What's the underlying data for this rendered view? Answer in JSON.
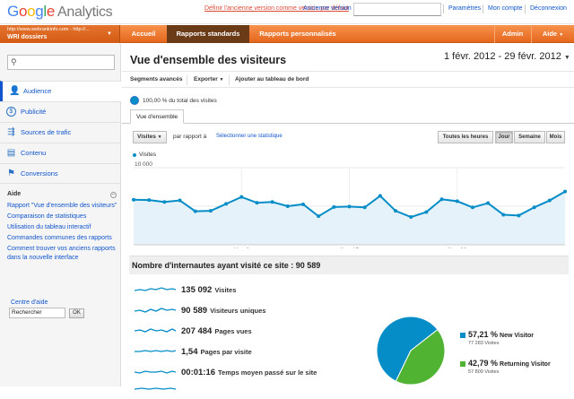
{
  "colors": {
    "accent_orange": "#e5671d",
    "link_blue": "#1155cc",
    "series_blue": "#058dc7",
    "series_green": "#50b432"
  },
  "topbar": {
    "logo_google": "Google",
    "logo_product": "Analytics",
    "make_default": "Définir l'ancienne version comme version par défaut",
    "old_version": "Ancienne version",
    "settings": "Paramètres",
    "account": "Mon compte",
    "logout": "Déconnexion"
  },
  "navbar": {
    "account_url": "http://www.webrankinfo.com - http://...",
    "account_name": "WRI dossiers",
    "home": "Accueil",
    "standard_reports": "Rapports standards",
    "custom_reports": "Rapports personnalisés",
    "admin": "Admin",
    "help": "Aide"
  },
  "sidebar": {
    "search_icon": "search-icon",
    "items": [
      {
        "label": "Audience",
        "icon": "person-icon"
      },
      {
        "label": "Publicité",
        "icon": "dollar-icon"
      },
      {
        "label": "Sources de trafic",
        "icon": "traffic-icon"
      },
      {
        "label": "Contenu",
        "icon": "content-icon"
      },
      {
        "label": "Conversions",
        "icon": "flag-icon"
      }
    ],
    "help_title": "Aide",
    "help_links": [
      "Rapport \"Vue d'ensemble des visiteurs\"",
      "Comparaison de statistiques",
      "Utilisation du tableau interactif",
      "Commandes communes des rapports",
      "Comment trouver vos anciens rapports dans la nouvelle interface"
    ],
    "help_center": "Centre d'aide",
    "search_value": "Rechercher",
    "ok": "OK"
  },
  "main": {
    "title": "Vue d'ensemble des visiteurs",
    "date_range": "1 févr. 2012 - 29 févr. 2012",
    "toolbar": {
      "segments": "Segments avancés",
      "export": "Exporter",
      "add_dashboard": "Ajouter au tableau de bord"
    },
    "pct_total": "100,00 % du total des visites",
    "tab": "Vue d'ensemble",
    "metric_select": "Visites",
    "vs": "par rapport à",
    "select_stat": "Sélectionner une statistique",
    "periods": [
      "Toutes les heures",
      "Jour",
      "Semaine",
      "Mois"
    ],
    "active_period": "Jour",
    "summary_title": "Nombre d'internautes ayant visité ce site : 90 589",
    "metrics": [
      {
        "value": "135 092",
        "label": "Visites"
      },
      {
        "value": "90 589",
        "label": "Visiteurs uniques"
      },
      {
        "value": "207 484",
        "label": "Pages vues"
      },
      {
        "value": "1,54",
        "label": "Pages par visite"
      },
      {
        "value": "00:01:16",
        "label": "Temps moyen passé sur le site"
      }
    ]
  },
  "chart_data": [
    {
      "type": "area",
      "series": [
        {
          "name": "Visites",
          "values": [
            5850,
            5800,
            5550,
            5750,
            4350,
            4400,
            5300,
            6200,
            5450,
            5550,
            5000,
            5250,
            3700,
            4900,
            4950,
            4850,
            6350,
            4400,
            3600,
            4250,
            5900,
            5650,
            4850,
            5400,
            3900,
            3800,
            4850,
            5750,
            6900
          ]
        }
      ],
      "x": [
        "1",
        "2",
        "3",
        "4",
        "5",
        "6",
        "7",
        "8",
        "9",
        "10",
        "11",
        "12",
        "13",
        "14",
        "15",
        "16",
        "17",
        "18",
        "19",
        "20",
        "21",
        "22",
        "23",
        "24",
        "25",
        "26",
        "27",
        "28",
        "29"
      ],
      "x_ticks": [
        "févr. 8",
        "févr. 15",
        "févr. 22"
      ],
      "y_ticks": [
        "10 000",
        "5 000"
      ],
      "ylim": [
        0,
        10000
      ],
      "grid": true
    },
    {
      "type": "pie",
      "slices": [
        {
          "name": "New Visitor",
          "percent": "57,21 %",
          "count": "77 283 Visites",
          "value": 57.21
        },
        {
          "name": "Returning Visitor",
          "percent": "42,79 %",
          "count": "57 809 Visites",
          "value": 42.79
        }
      ]
    }
  ]
}
